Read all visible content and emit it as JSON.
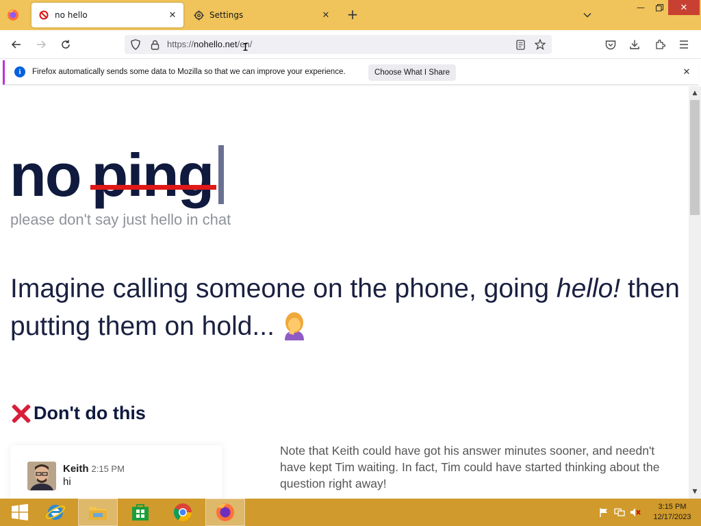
{
  "browser": {
    "tabs": [
      {
        "label": "no hello",
        "active": true,
        "icon": "no-entry-icon"
      },
      {
        "label": "Settings",
        "active": false,
        "icon": "gear-icon"
      }
    ],
    "url_prefix": "https://",
    "url_host": "nohello.net",
    "url_path": "/en/",
    "notification": {
      "text": "Firefox automatically sends some data to Mozilla so that we can improve your experience.",
      "button": "Choose What I Share"
    }
  },
  "page": {
    "heading_word1": "no",
    "heading_word2": "ping",
    "subtitle": "please don't say just hello in chat",
    "lead_part1": "Imagine calling someone on the phone, going ",
    "lead_em": "hello!",
    "lead_part2": " then putting them on hold... ",
    "dont_heading": "Don't do this",
    "chat": {
      "name": "Keith",
      "time": "2:15 PM",
      "message": "hi"
    },
    "note": "Note that Keith could have got his answer minutes sooner, and needn't have kept Tim waiting. In fact, Tim could have started thinking about the question right away!"
  },
  "taskbar": {
    "clock_time": "3:15 PM",
    "clock_date": "12/17/2023"
  },
  "colors": {
    "titlebar": "#f0c45a",
    "taskbar": "#d09a2c",
    "heading": "#101a3e",
    "strike": "#e01818",
    "cross": "#d91e3a"
  }
}
